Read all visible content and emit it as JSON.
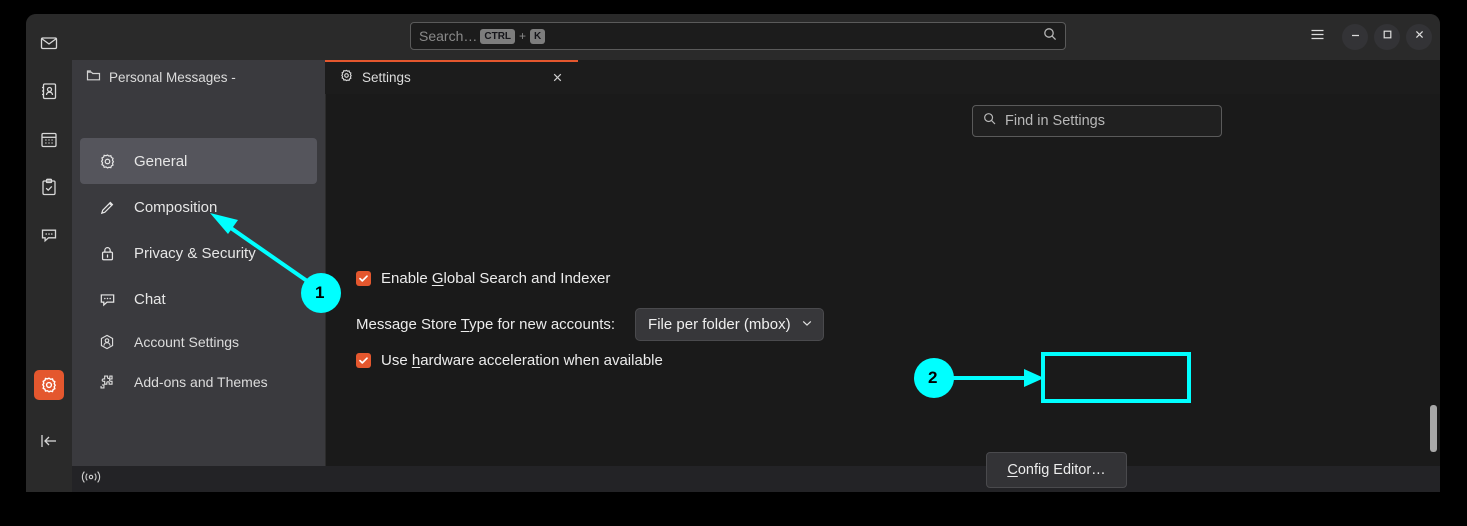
{
  "window": {
    "search": {
      "placeholder": "Search…",
      "kbd_mod": "CTRL",
      "kbd_plus": "+",
      "kbd_key": "K",
      "icon": "search-icon"
    },
    "controls": {
      "menu": "hamburger-menu-icon",
      "minimize": "minimize-icon",
      "maximize": "maximize-icon",
      "close": "close-icon"
    }
  },
  "rail": {
    "items": [
      {
        "icon": "mail-icon",
        "name": "mail"
      },
      {
        "icon": "address-book-icon",
        "name": "address-book"
      },
      {
        "icon": "calendar-icon",
        "name": "calendar"
      },
      {
        "icon": "tasks-icon",
        "name": "tasks"
      },
      {
        "icon": "chat-icon",
        "name": "chat"
      }
    ],
    "settings": {
      "icon": "gear-icon",
      "name": "settings",
      "active": true
    },
    "collapse": {
      "icon": "collapse-panel-icon",
      "name": "collapse"
    }
  },
  "tabs": [
    {
      "label": "Personal Messages -",
      "icon": "folder-icon",
      "active": false,
      "closable": false
    },
    {
      "label": "Settings",
      "icon": "gear-icon",
      "active": true,
      "closable": true
    }
  ],
  "nav": {
    "items": [
      {
        "label": "General",
        "icon": "gear-icon",
        "selected": true
      },
      {
        "label": "Composition",
        "icon": "pencil-icon",
        "selected": false
      },
      {
        "label": "Privacy & Security",
        "icon": "lock-icon",
        "selected": false
      },
      {
        "label": "Chat",
        "icon": "chat-bubble-icon",
        "selected": false
      },
      {
        "label": "Account Settings",
        "icon": "account-icon",
        "selected": false
      },
      {
        "label": "Add-ons and Themes",
        "icon": "puzzle-icon",
        "selected": false
      }
    ]
  },
  "settings_pane": {
    "find": {
      "placeholder": "Find in Settings",
      "icon": "search-icon"
    },
    "global_search": {
      "label_before": "Enable ",
      "label_accesskey": "G",
      "label_after": "lobal Search and Indexer",
      "checked": true
    },
    "message_store": {
      "label_before": "Message Store ",
      "label_accesskey": "T",
      "label_after": "ype for new accounts:",
      "value": "File per folder (mbox)",
      "chevron": "chevron-down-icon"
    },
    "hardware_accel": {
      "label_before": "Use ",
      "label_accesskey": "h",
      "label_after": "ardware acceleration when available",
      "checked": true
    },
    "config_editor": {
      "label_accesskey": "C",
      "label_after": "onfig Editor…"
    }
  },
  "statusbar": {
    "icon": "broadcast-icon"
  },
  "annotations": [
    {
      "number": "1",
      "target": "sidebar-item-general"
    },
    {
      "number": "2",
      "target": "config-editor-button"
    }
  ],
  "colors": {
    "accent": "#e4572e",
    "annotation": "#00ffff",
    "window_bg": "#1c1c1c",
    "nav_bg": "#3a3a3e"
  }
}
